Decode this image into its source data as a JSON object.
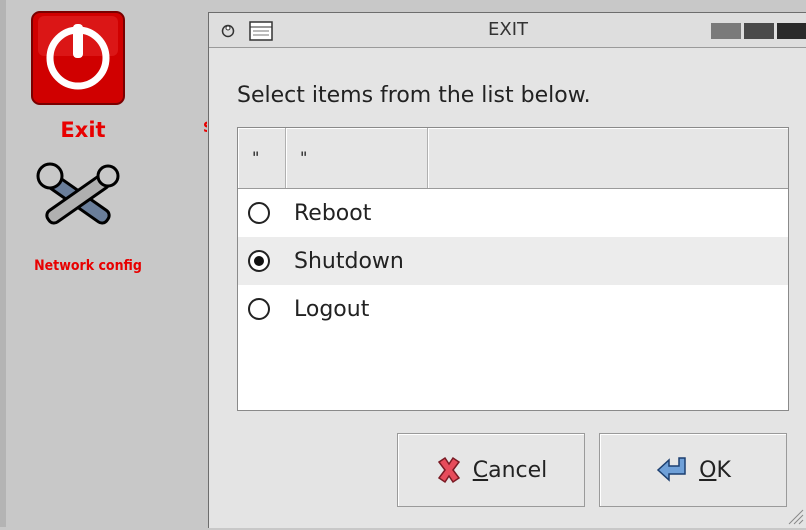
{
  "desktop": {
    "icons": [
      {
        "label": "Exit",
        "icon": "power-icon"
      },
      {
        "label": "Network config",
        "icon": "tools-icon"
      }
    ]
  },
  "window": {
    "title": "EXIT",
    "prompt": "Select items from the list below.",
    "columns": [
      "\"",
      "\"",
      ""
    ],
    "items": [
      {
        "label": "Reboot",
        "selected": false
      },
      {
        "label": "Shutdown",
        "selected": true
      },
      {
        "label": "Logout",
        "selected": false
      }
    ],
    "buttons": {
      "cancel": {
        "mnemonic": "C",
        "rest": "ancel",
        "icon": "cancel-x-icon"
      },
      "ok": {
        "mnemonic": "O",
        "rest": "K",
        "icon": "ok-arrow-icon"
      }
    }
  },
  "colors": {
    "accent": "#e80000",
    "selection_row": "#ececec"
  }
}
